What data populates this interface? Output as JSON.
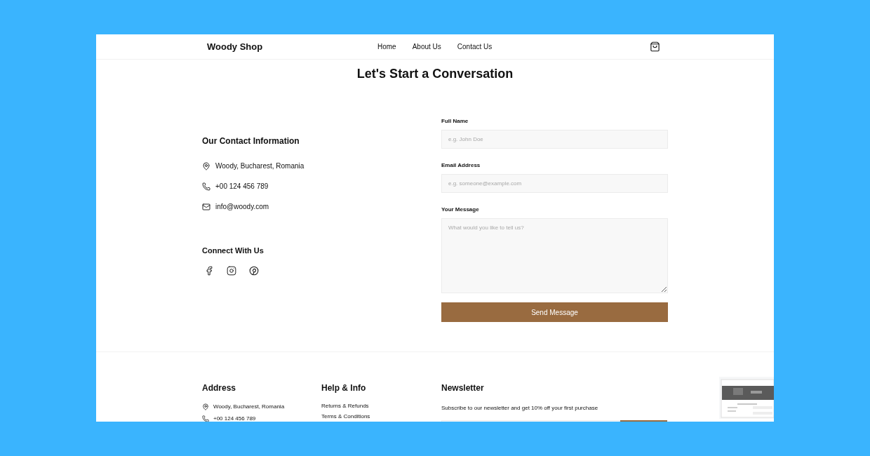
{
  "nav": {
    "logo": "Woody Shop",
    "links": [
      {
        "label": "Home"
      },
      {
        "label": "About Us"
      },
      {
        "label": "Contact Us"
      }
    ]
  },
  "title": "Let's Start a Conversation",
  "contact": {
    "heading": "Our Contact Information",
    "items": [
      {
        "kind": "location",
        "text": "Woody, Bucharest, Romania"
      },
      {
        "kind": "phone",
        "text": "+00 124 456 789"
      },
      {
        "kind": "email",
        "text": "info@woody.com"
      }
    ],
    "social_heading": "Connect With Us",
    "social": [
      {
        "kind": "facebook"
      },
      {
        "kind": "instagram"
      },
      {
        "kind": "pinterest"
      }
    ]
  },
  "form": {
    "fields": [
      {
        "kind": "input",
        "label": "Full Name",
        "placeholder": "e.g. John Doe"
      },
      {
        "kind": "input",
        "label": "Email Address",
        "placeholder": "e.g. someone@example.com"
      },
      {
        "kind": "textarea",
        "label": "Your Message",
        "placeholder": "What would you like to tell us?"
      }
    ],
    "submit": "Send Message"
  },
  "footer": {
    "address": {
      "heading": "Address",
      "items": [
        {
          "kind": "location",
          "text": "Woody, Bucharest, Romania"
        },
        {
          "kind": "phone",
          "text": "+00 124 456 789"
        }
      ]
    },
    "help": {
      "heading": "Help & Info",
      "links": [
        "Returns & Refunds",
        "Terms & Conditions"
      ]
    },
    "newsletter": {
      "heading": "Newsletter",
      "text": "Subscribe to our newsletter and get 10% off your first purchase"
    }
  }
}
